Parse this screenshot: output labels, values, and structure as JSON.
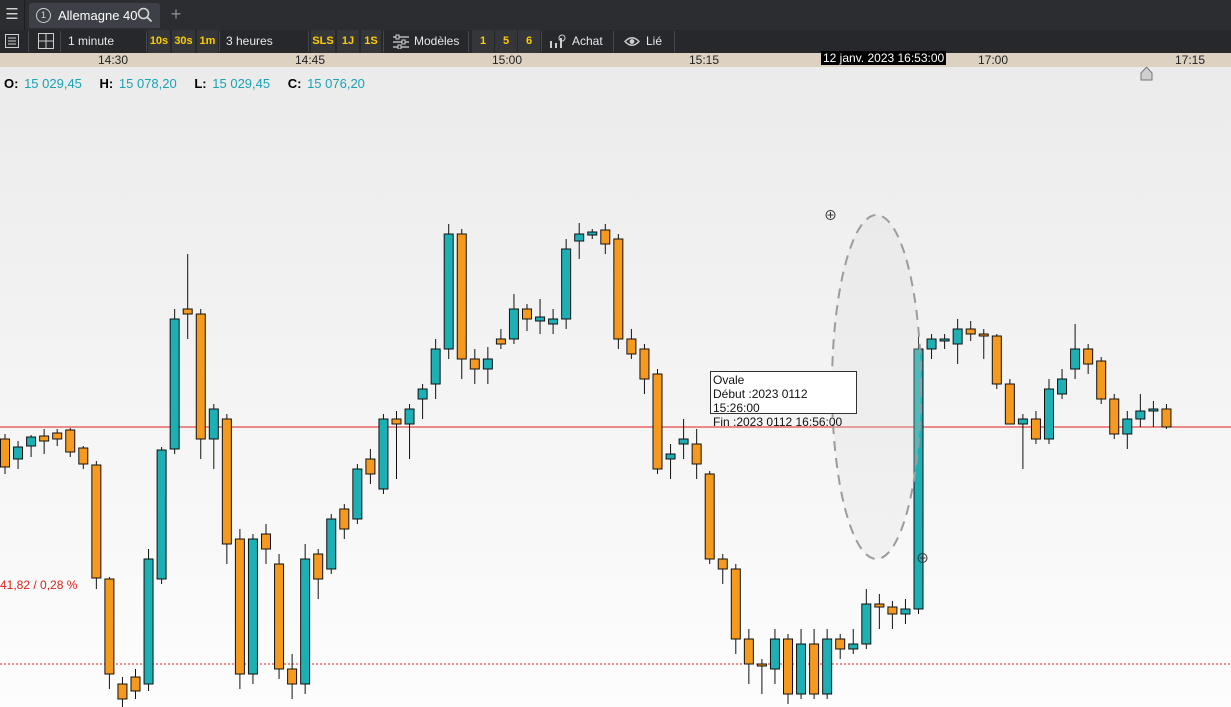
{
  "tab": {
    "number": "1",
    "instrument": "Allemagne 40"
  },
  "toolbar": {
    "interval": "1 minute",
    "quick_intervals": [
      "10s",
      "30s",
      "1m"
    ],
    "range": "3 heures",
    "quick_ranges": [
      "SLS",
      "1J",
      "1S"
    ],
    "templates_label": "Modèles",
    "layout_slots": [
      "1",
      "5",
      "6"
    ],
    "buy_label": "Achat",
    "linked_label": "Lié"
  },
  "time_axis": {
    "ticks": [
      "14:30",
      "14:45",
      "15:00",
      "15:15",
      "17:00",
      "17:15"
    ],
    "cursor_label": "12 janv. 2023 16:53:00"
  },
  "ohlc": {
    "open_label": "O:",
    "open": "15 029,45",
    "high_label": "H:",
    "high": "15 078,20",
    "low_label": "L:",
    "low": "15 029,45",
    "close_label": "C:",
    "close": "15 076,20"
  },
  "reference_line_label": "41,82 / 0,28 %",
  "annotation": {
    "shape": "Ovale",
    "start": "Début :2023 0112 15:26:00",
    "end": "Fin :2023 0112 16:56:00"
  },
  "colors": {
    "bullish": "#1cb0b4",
    "bearish": "#f59a1e",
    "price_line": "#e0201b",
    "axis_bg": "#ddd2c1",
    "toolbar_bg": "#26282c",
    "quick_button_text": "#ffcc00"
  },
  "chart_data": {
    "type": "candlestick",
    "timeframe": "1 minute",
    "candles": [
      {
        "o": 340,
        "c": 312,
        "h": 345,
        "l": 305
      },
      {
        "o": 320,
        "c": 332,
        "h": 338,
        "l": 310
      },
      {
        "o": 333,
        "c": 342,
        "h": 344,
        "l": 322
      },
      {
        "o": 343,
        "c": 338,
        "h": 350,
        "l": 325
      },
      {
        "o": 346,
        "c": 340,
        "h": 350,
        "l": 333
      },
      {
        "o": 349,
        "c": 327,
        "h": 351,
        "l": 322
      },
      {
        "o": 331,
        "c": 315,
        "h": 333,
        "l": 310
      },
      {
        "o": 314,
        "c": 201,
        "h": 318,
        "l": 190
      },
      {
        "o": 200,
        "c": 105,
        "h": 202,
        "l": 90
      },
      {
        "o": 95,
        "c": 80,
        "h": 102,
        "l": 72
      },
      {
        "o": 102,
        "c": 88,
        "h": 110,
        "l": 80
      },
      {
        "o": 95,
        "c": 220,
        "h": 230,
        "l": 88
      },
      {
        "o": 200,
        "c": 329,
        "h": 332,
        "l": 195
      },
      {
        "o": 330,
        "c": 460,
        "h": 470,
        "l": 325
      },
      {
        "o": 470,
        "c": 465,
        "h": 525,
        "l": 440
      },
      {
        "o": 465,
        "c": 340,
        "h": 470,
        "l": 320
      },
      {
        "o": 340,
        "c": 370,
        "h": 375,
        "l": 310
      },
      {
        "o": 360,
        "c": 235,
        "h": 365,
        "l": 215
      },
      {
        "o": 240,
        "c": 105,
        "h": 250,
        "l": 90
      },
      {
        "o": 105,
        "c": 240,
        "h": 245,
        "l": 95
      },
      {
        "o": 245,
        "c": 230,
        "h": 255,
        "l": 215
      },
      {
        "o": 215,
        "c": 110,
        "h": 225,
        "l": 100
      },
      {
        "o": 110,
        "c": 95,
        "h": 125,
        "l": 80
      },
      {
        "o": 95,
        "c": 220,
        "h": 235,
        "l": 85
      },
      {
        "o": 225,
        "c": 200,
        "h": 230,
        "l": 180
      },
      {
        "o": 210,
        "c": 260,
        "h": 265,
        "l": 205
      },
      {
        "o": 270,
        "c": 250,
        "h": 275,
        "l": 240
      },
      {
        "o": 260,
        "c": 310,
        "h": 315,
        "l": 255
      },
      {
        "o": 320,
        "c": 305,
        "h": 330,
        "l": 295
      },
      {
        "o": 290,
        "c": 360,
        "h": 365,
        "l": 285
      },
      {
        "o": 360,
        "c": 355,
        "h": 368,
        "l": 300
      },
      {
        "o": 355,
        "c": 370,
        "h": 375,
        "l": 320
      },
      {
        "o": 380,
        "c": 390,
        "h": 395,
        "l": 360
      },
      {
        "o": 395,
        "c": 430,
        "h": 440,
        "l": 380
      },
      {
        "o": 430,
        "c": 545,
        "h": 555,
        "l": 420
      },
      {
        "o": 545,
        "c": 420,
        "h": 550,
        "l": 400
      },
      {
        "o": 420,
        "c": 410,
        "h": 430,
        "l": 395
      },
      {
        "o": 410,
        "c": 420,
        "h": 432,
        "l": 395
      },
      {
        "o": 440,
        "c": 435,
        "h": 450,
        "l": 430
      },
      {
        "o": 440,
        "c": 470,
        "h": 485,
        "l": 435
      },
      {
        "o": 470,
        "c": 460,
        "h": 475,
        "l": 448
      },
      {
        "o": 458,
        "c": 462,
        "h": 480,
        "l": 445
      },
      {
        "o": 455,
        "c": 460,
        "h": 470,
        "l": 445
      },
      {
        "o": 460,
        "c": 530,
        "h": 540,
        "l": 450
      },
      {
        "o": 538,
        "c": 545,
        "h": 556,
        "l": 520
      },
      {
        "o": 544,
        "c": 547,
        "h": 550,
        "l": 540
      },
      {
        "o": 549,
        "c": 535,
        "h": 555,
        "l": 525
      },
      {
        "o": 540,
        "c": 440,
        "h": 545,
        "l": 430
      },
      {
        "o": 440,
        "c": 425,
        "h": 450,
        "l": 420
      },
      {
        "o": 430,
        "c": 400,
        "h": 435,
        "l": 385
      },
      {
        "o": 405,
        "c": 310,
        "h": 410,
        "l": 305
      },
      {
        "o": 320,
        "c": 325,
        "h": 335,
        "l": 300
      },
      {
        "o": 335,
        "c": 340,
        "h": 360,
        "l": 320
      },
      {
        "o": 335,
        "c": 315,
        "h": 350,
        "l": 300
      },
      {
        "o": 305,
        "c": 220,
        "h": 308,
        "l": 215
      },
      {
        "o": 220,
        "c": 210,
        "h": 225,
        "l": 195
      },
      {
        "o": 210,
        "c": 140,
        "h": 215,
        "l": 125
      },
      {
        "o": 140,
        "c": 115,
        "h": 150,
        "l": 95
      },
      {
        "o": 115,
        "c": 113,
        "h": 120,
        "l": 85
      },
      {
        "o": 110,
        "c": 140,
        "h": 150,
        "l": 95
      },
      {
        "o": 140,
        "c": 85,
        "h": 145,
        "l": 75
      },
      {
        "o": 85,
        "c": 135,
        "h": 150,
        "l": 80
      },
      {
        "o": 135,
        "c": 85,
        "h": 150,
        "l": 80
      },
      {
        "o": 85,
        "c": 140,
        "h": 150,
        "l": 80
      },
      {
        "o": 140,
        "c": 130,
        "h": 145,
        "l": 120
      },
      {
        "o": 130,
        "c": 135,
        "h": 150,
        "l": 125
      },
      {
        "o": 135,
        "c": 175,
        "h": 190,
        "l": 130
      },
      {
        "o": 175,
        "c": 172,
        "h": 185,
        "l": 150
      },
      {
        "o": 172,
        "c": 165,
        "h": 178,
        "l": 150
      },
      {
        "o": 165,
        "c": 170,
        "h": 180,
        "l": 155
      },
      {
        "o": 170,
        "c": 430,
        "h": 445,
        "l": 165
      },
      {
        "o": 430,
        "c": 440,
        "h": 445,
        "l": 420
      },
      {
        "o": 438,
        "c": 440,
        "h": 445,
        "l": 430
      },
      {
        "o": 435,
        "c": 450,
        "h": 460,
        "l": 415
      },
      {
        "o": 450,
        "c": 445,
        "h": 458,
        "l": 438
      },
      {
        "o": 445,
        "c": 443,
        "h": 450,
        "l": 420
      },
      {
        "o": 443,
        "c": 395,
        "h": 445,
        "l": 390
      },
      {
        "o": 395,
        "c": 355,
        "h": 400,
        "l": 355
      },
      {
        "o": 355,
        "c": 360,
        "h": 365,
        "l": 310
      },
      {
        "o": 360,
        "c": 340,
        "h": 368,
        "l": 335
      },
      {
        "o": 340,
        "c": 390,
        "h": 400,
        "l": 335
      },
      {
        "o": 385,
        "c": 400,
        "h": 410,
        "l": 380
      },
      {
        "o": 410,
        "c": 430,
        "h": 455,
        "l": 400
      },
      {
        "o": 430,
        "c": 415,
        "h": 435,
        "l": 405
      },
      {
        "o": 418,
        "c": 380,
        "h": 422,
        "l": 375
      },
      {
        "o": 380,
        "c": 345,
        "h": 385,
        "l": 340
      },
      {
        "o": 345,
        "c": 360,
        "h": 368,
        "l": 330
      },
      {
        "o": 360,
        "c": 368,
        "h": 385,
        "l": 352
      },
      {
        "o": 368,
        "c": 370,
        "h": 378,
        "l": 352
      },
      {
        "o": 370,
        "c": 352,
        "h": 375,
        "l": 350
      }
    ],
    "horizontal_lines": [
      {
        "style": "solid",
        "value": 352
      },
      {
        "style": "dotted",
        "value": 115,
        "label": "41,82 / 0,28 %"
      }
    ]
  }
}
